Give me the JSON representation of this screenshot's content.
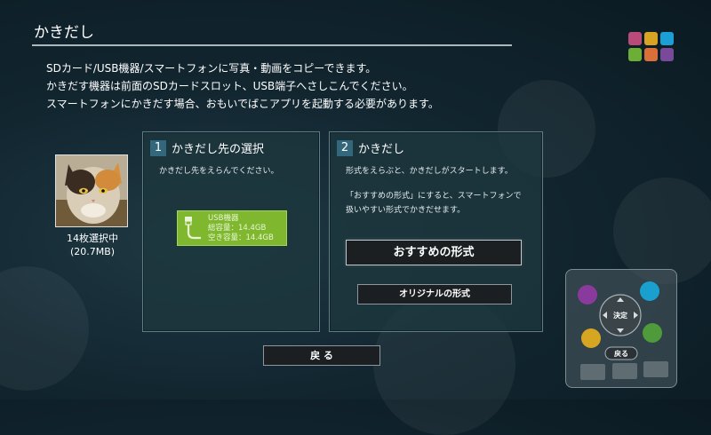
{
  "header": {
    "title": "かきだし"
  },
  "palette": {
    "colors": [
      "#b94b7b",
      "#d9a423",
      "#1c9fd5",
      "#6cae36",
      "#d9703a",
      "#7a4a9a"
    ]
  },
  "intro": {
    "line1": "SDカード/USB機器/スマートフォンに写真・動画をコピーできます。",
    "line2": "かきだす機器は前面のSDカードスロット、USB端子へさしこんでください。",
    "line3": "スマートフォンにかきだす場合、おもいでばこアプリを起動する必要があります。"
  },
  "selection": {
    "count_label": "14枚選択中",
    "size_label": "(20.7MB)"
  },
  "step1": {
    "number": "1",
    "title": "かきだし先の選択",
    "desc": "かきだし先をえらんでください。",
    "device": {
      "name": "USB機器",
      "total": "総容量：14.4GB",
      "free": "空き容量：14.4GB",
      "color": "#7fb82e"
    }
  },
  "step2": {
    "number": "2",
    "title": "かきだし",
    "desc1": "形式をえらぶと、かきだしがスタートします。",
    "desc2": "「おすすめの形式」にすると、スマートフォンで",
    "desc3": "扱いやすい形式でかきだせます。",
    "recommended_button": "おすすめの形式",
    "original_button": "オリジナルの形式"
  },
  "back_button": "戻 る",
  "remote": {
    "ok_label": "決定",
    "back_label": "戻る",
    "colors": {
      "purple": "#8a3a9c",
      "blue": "#1aa0cf",
      "yellow": "#d6a623",
      "green": "#4f9a3a"
    }
  }
}
